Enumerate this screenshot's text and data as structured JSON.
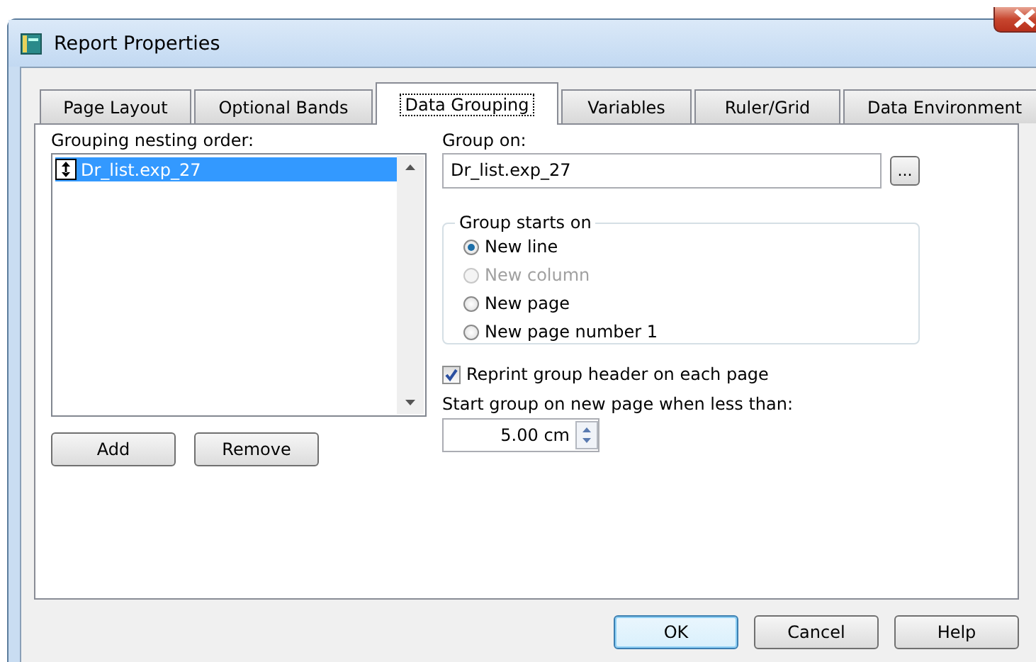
{
  "window": {
    "title": "Report Properties"
  },
  "tabs": [
    {
      "label": "Page Layout",
      "selected": false
    },
    {
      "label": "Optional Bands",
      "selected": false
    },
    {
      "label": "Data Grouping",
      "selected": true
    },
    {
      "label": "Variables",
      "selected": false
    },
    {
      "label": "Ruler/Grid",
      "selected": false
    },
    {
      "label": "Data Environment",
      "selected": false
    }
  ],
  "grouping": {
    "label": "Grouping nesting order:",
    "items": [
      {
        "text": "Dr_list.exp_27",
        "selected": true
      }
    ],
    "buttons": [
      "Add",
      "Remove"
    ]
  },
  "group_on": {
    "label": "Group on:",
    "value": "Dr_list.exp_27",
    "browse_button": "..."
  },
  "group_starts_on": {
    "title": "Group starts on",
    "options": [
      {
        "label": "New line",
        "selected": true,
        "disabled": false
      },
      {
        "label": "New column",
        "selected": false,
        "disabled": true
      },
      {
        "label": "New page",
        "selected": false,
        "disabled": false
      },
      {
        "label": "New page number 1",
        "selected": false,
        "disabled": false
      }
    ]
  },
  "reprint": {
    "label": "Reprint group header on each page",
    "checked": true
  },
  "start_new_page": {
    "label": "Start group on new page when less than:",
    "value": "5.00 cm"
  },
  "buttons": [
    {
      "label": "OK",
      "default": true
    },
    {
      "label": "Cancel",
      "default": false
    },
    {
      "label": "Help",
      "default": false
    }
  ]
}
